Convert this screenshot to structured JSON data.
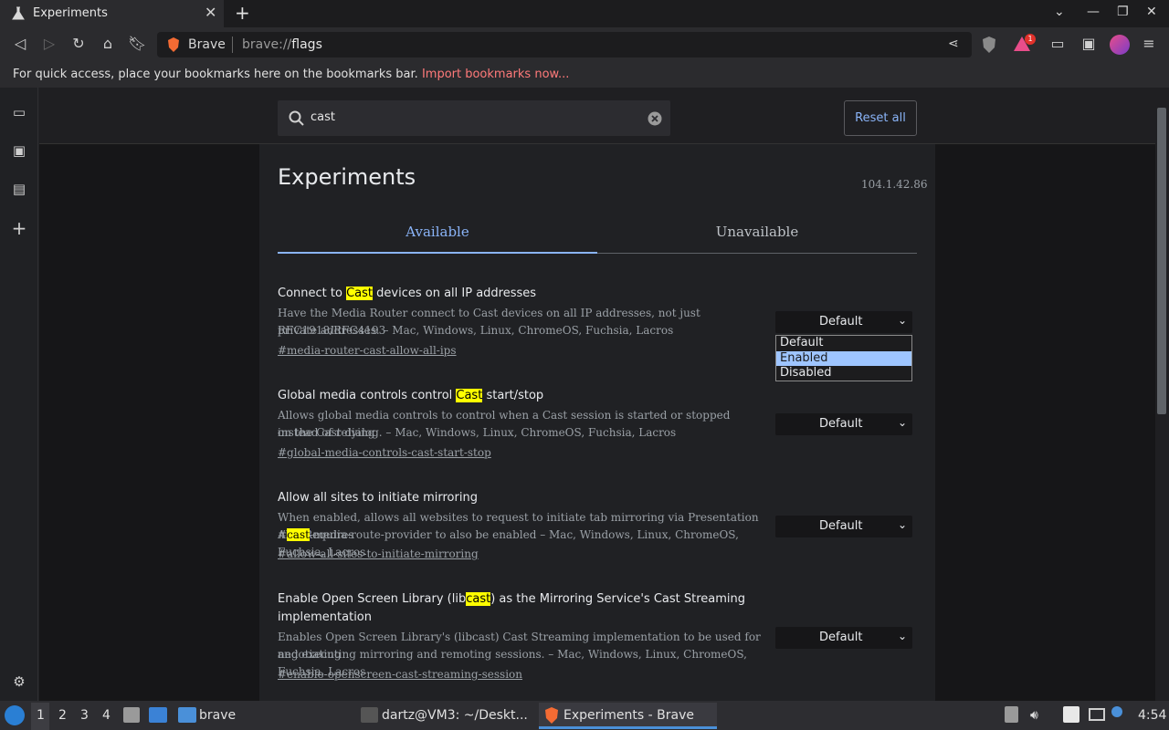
{
  "browser": {
    "tab_title": "Experiments",
    "omnibox_brand": "Brave",
    "url_prefix": "brave://",
    "url_path": "flags",
    "alert_count": "1"
  },
  "bookmarks_bar": {
    "message": "For quick access, place your bookmarks here on the bookmarks bar.",
    "import_link": "Import bookmarks now..."
  },
  "search": {
    "value": "cast",
    "reset_label": "Reset all"
  },
  "page": {
    "title": "Experiments",
    "version": "104.1.42.86",
    "tabs": [
      "Available",
      "Unavailable"
    ],
    "active_tab": "Available"
  },
  "flags": [
    {
      "title_pre": "Connect to ",
      "title_hl": "Cast",
      "title_post": " devices on all IP addresses",
      "desc_line1": "Have the Media Router connect to Cast devices on all IP addresses, not just RFC1918/RFC4193",
      "desc_line2": "private addresses. – Mac, Windows, Linux, ChromeOS, Fuchsia, Lacros",
      "link": "#media-router-cast-allow-all-ips",
      "value": "Default"
    },
    {
      "title_pre": "Global media controls control ",
      "title_hl": "Cast",
      "title_post": " start/stop",
      "desc_line1": "Allows global media controls to control when a Cast session is started or stopped instead of relying",
      "desc_line2": "on the Cast dialog. – Mac, Windows, Linux, ChromeOS, Fuchsia, Lacros",
      "link": "#global-media-controls-cast-start-stop",
      "value": "Default"
    },
    {
      "title": "Allow all sites to initiate mirroring",
      "desc_line1": "When enabled, allows all websites to request to initiate tab mirroring via Presentation API. Requires",
      "desc_line2_pre": "#",
      "desc_line2_hl": "cast",
      "desc_line2_post": "-media-route-provider to also be enabled – Mac, Windows, Linux, ChromeOS, Fuchsia, Lacros",
      "link": "#allow-all-sites-to-initiate-mirroring",
      "value": "Default"
    },
    {
      "title_pre": "Enable Open Screen Library (lib",
      "title_hl": "cast",
      "title_post": ") as the Mirroring Service's Cast Streaming",
      "title_line2": "implementation",
      "desc_line1": "Enables Open Screen Library's (libcast) Cast Streaming implementation to be used for negotiating",
      "desc_line2": "and executing mirroring and remoting sessions. – Mac, Windows, Linux, ChromeOS, Fuchsia, Lacros",
      "link": "#enable-openscreen-cast-streaming-session",
      "value": "Default"
    }
  ],
  "dropdown_options": [
    "Default",
    "Enabled",
    "Disabled"
  ],
  "dropdown_highlighted": "Enabled",
  "taskbar": {
    "workspaces": [
      "1",
      "2",
      "3",
      "4"
    ],
    "folder_label": "brave",
    "terminal_label": "dartz@VM3: ~/Deskt...",
    "browser_label": "Experiments - Brave",
    "clock": "4:54"
  },
  "colors": {
    "accent": "#8ab4f8",
    "highlight": "#ffff00",
    "link_red": "#ff7a7a"
  }
}
